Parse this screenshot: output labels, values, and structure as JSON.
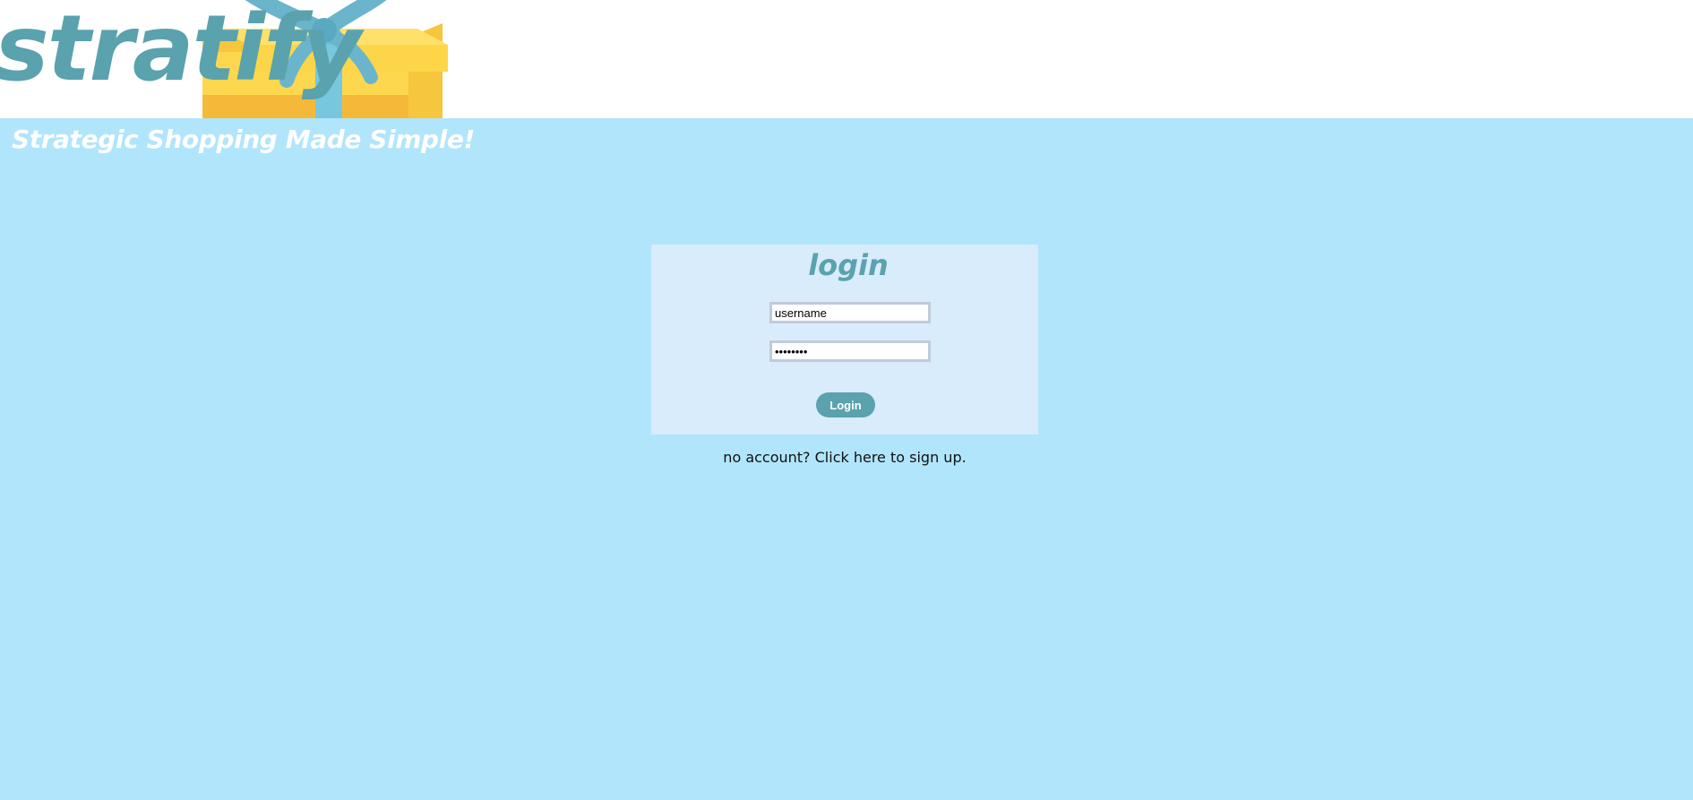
{
  "header": {
    "brand": "stratify",
    "logo_icon": "gift-box-icon",
    "tagline": "Strategic Shopping Made Simple!"
  },
  "login": {
    "title": "login",
    "username": {
      "value": "username",
      "placeholder": "username"
    },
    "password": {
      "value": "password"
    },
    "submit_label": "Login"
  },
  "signup": {
    "text": "no account? Click here to sign up."
  },
  "colors": {
    "page_background": "#b1e5fb",
    "header_background": "#ffffff",
    "accent": "#5aa2ad",
    "panel_background": "#d8ecfc",
    "gift_yellow": "#fdd84f",
    "ribbon_blue": "#77c8de"
  }
}
